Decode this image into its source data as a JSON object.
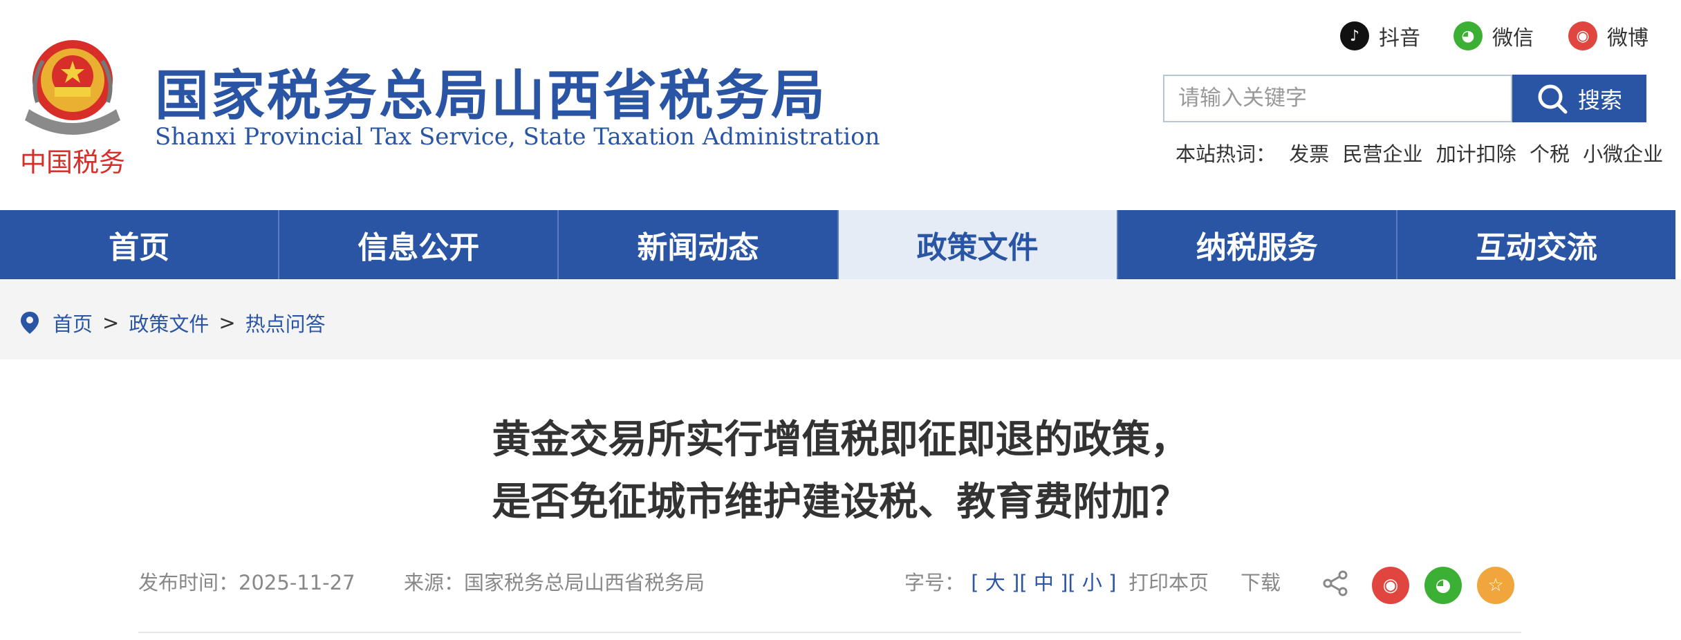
{
  "header": {
    "title": "国家税务总局山西省税务局",
    "subtitle": "Shanxi Provincial Tax Service, State Taxation Administration",
    "emblem_caption": "中国税务",
    "social": [
      {
        "label": "抖音",
        "icon": "tiktok-icon",
        "color": "#111111"
      },
      {
        "label": "微信",
        "icon": "wechat-icon",
        "color": "#3cb034"
      },
      {
        "label": "微博",
        "icon": "weibo-icon",
        "color": "#e0463f"
      }
    ],
    "search": {
      "placeholder": "请输入关键字",
      "button_label": "搜索"
    },
    "hot": {
      "label": "本站热词：",
      "words": [
        "发票",
        "民营企业",
        "加计扣除",
        "个税",
        "小微企业"
      ]
    }
  },
  "nav": {
    "items": [
      "首页",
      "信息公开",
      "新闻动态",
      "政策文件",
      "纳税服务",
      "互动交流"
    ],
    "active_index": 3
  },
  "breadcrumb": [
    "首页",
    "政策文件",
    "热点问答"
  ],
  "article": {
    "title_line1": "黄金交易所实行增值税即征即退的政策，",
    "title_line2": "是否免征城市维护建设税、教育费附加？",
    "publish_label": "发布时间：",
    "publish_date": "2025-11-27",
    "source_label": "来源：",
    "source": "国家税务总局山西省税务局",
    "fontsize_label": "字号：",
    "fontsize_options": [
      "[ 大 ]",
      "[ 中 ]",
      "[ 小 ]"
    ],
    "print_label": "打印本页",
    "download_label": "下载"
  },
  "colors": {
    "brand": "#2a55a4",
    "nav_active_bg": "#e6ecf5",
    "weibo": "#e0463f",
    "wechat": "#3cb034",
    "favorite": "#f0a63c"
  }
}
